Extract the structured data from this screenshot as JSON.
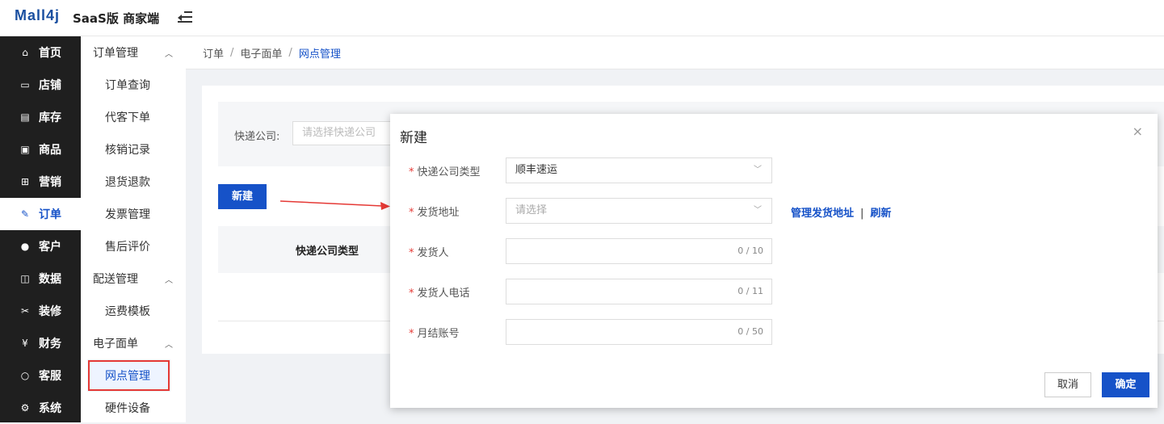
{
  "header": {
    "logo": "Mall4j",
    "subtitle": "SaaS版 商家端"
  },
  "sidebar": {
    "items": [
      {
        "label": "首页",
        "icon": "home-icon"
      },
      {
        "label": "店铺",
        "icon": "shop-icon"
      },
      {
        "label": "库存",
        "icon": "inventory-icon"
      },
      {
        "label": "商品",
        "icon": "product-icon"
      },
      {
        "label": "营销",
        "icon": "gift-icon"
      },
      {
        "label": "订单",
        "icon": "order-icon"
      },
      {
        "label": "客户",
        "icon": "user-icon"
      },
      {
        "label": "数据",
        "icon": "chart-icon"
      },
      {
        "label": "装修",
        "icon": "brush-icon"
      },
      {
        "label": "财务",
        "icon": "finance-icon"
      },
      {
        "label": "客服",
        "icon": "chat-icon"
      },
      {
        "label": "系统",
        "icon": "settings-icon"
      }
    ]
  },
  "submenu": {
    "group1": "订单管理",
    "g1_items": [
      "订单查询",
      "代客下单",
      "核销记录",
      "退货退款",
      "发票管理",
      "售后评价"
    ],
    "group2": "配送管理",
    "g2_items": [
      "运费模板"
    ],
    "group3": "电子面单",
    "g3_items": [
      "网点管理",
      "硬件设备"
    ]
  },
  "breadcrumb": {
    "a": "订单",
    "b": "电子面单",
    "c": "网点管理"
  },
  "filter": {
    "label": "快递公司:",
    "placeholder": "请选择快递公司"
  },
  "page": {
    "new_label": "新建",
    "col1": "快递公司类型"
  },
  "modal": {
    "title": "新建",
    "close": "×",
    "fields": [
      {
        "label": "快递公司类型",
        "value": "顺丰速运"
      },
      {
        "label": "发货地址",
        "placeholder": "请选择"
      },
      {
        "label": "发货人",
        "count": "0 / 10"
      },
      {
        "label": "发货人电话",
        "count": "0 / 11"
      },
      {
        "label": "月结账号",
        "count": "0 / 50"
      }
    ],
    "link_manage": "管理发货地址",
    "link_refresh": "刷新",
    "cancel": "取消",
    "ok": "确定"
  },
  "colors": {
    "primary": "#1652c8",
    "sidebar": "#1f1f1f",
    "highlight": "#e53935"
  }
}
